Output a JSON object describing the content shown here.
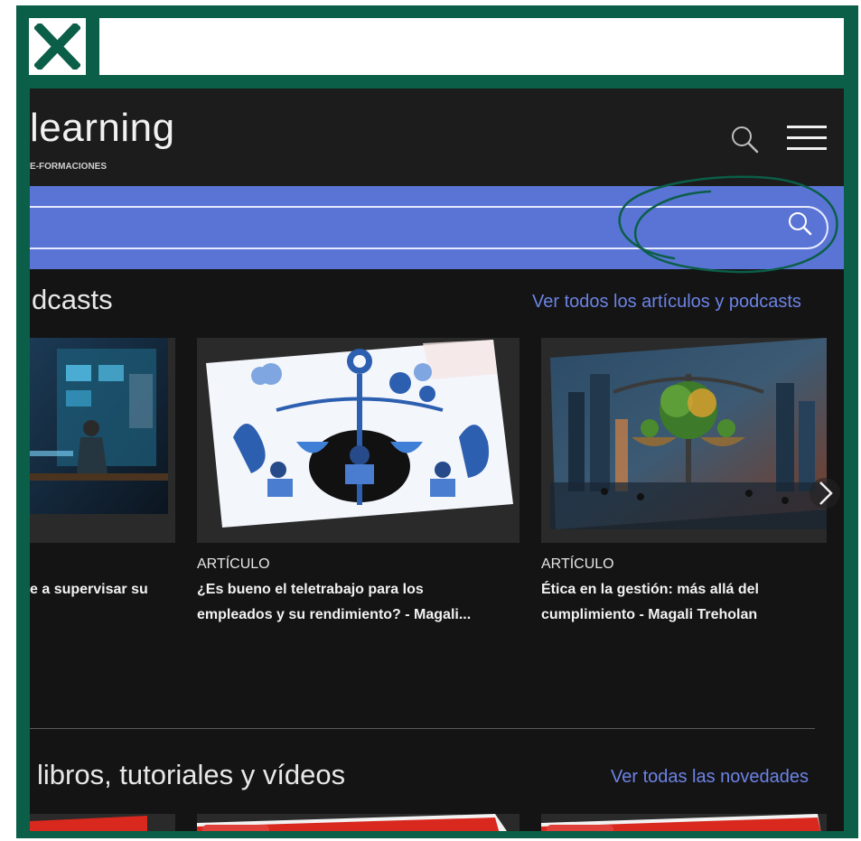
{
  "brand": {
    "logo_text": "learning",
    "logo_subtitle": "E-FORMACIONES"
  },
  "colors": {
    "frame": "#0b5e47",
    "header_bg": "#1c1c1c",
    "page_bg": "#141414",
    "search_band": "#5a74d6",
    "link": "#6c83e6",
    "annotation": "#0b5e47"
  },
  "icons": {
    "close": "close-icon",
    "header_search": "search-icon",
    "menu": "hamburger-menu-icon",
    "search_submit": "search-icon",
    "carousel_next": "chevron-right-icon"
  },
  "search": {
    "value": "",
    "placeholder": ""
  },
  "sections": {
    "articles": {
      "title": "dcasts",
      "link": "Ver todos los artículos y podcasts"
    },
    "novelties": {
      "title": "libros, tutoriales y vídeos",
      "link": "Ver todas las novedades"
    }
  },
  "cards": [
    {
      "type": "",
      "title_line1": "e a supervisar su",
      "title_line2": ""
    },
    {
      "type": "ARTÍCULO",
      "title_line1": "¿Es bueno el teletrabajo para los",
      "title_line2": "empleados y su rendimiento? - Magali..."
    },
    {
      "type": "ARTÍCULO",
      "title_line1": "Ética en la gestión: más allá del",
      "title_line2": "cumplimiento - Magali Treholan"
    }
  ]
}
